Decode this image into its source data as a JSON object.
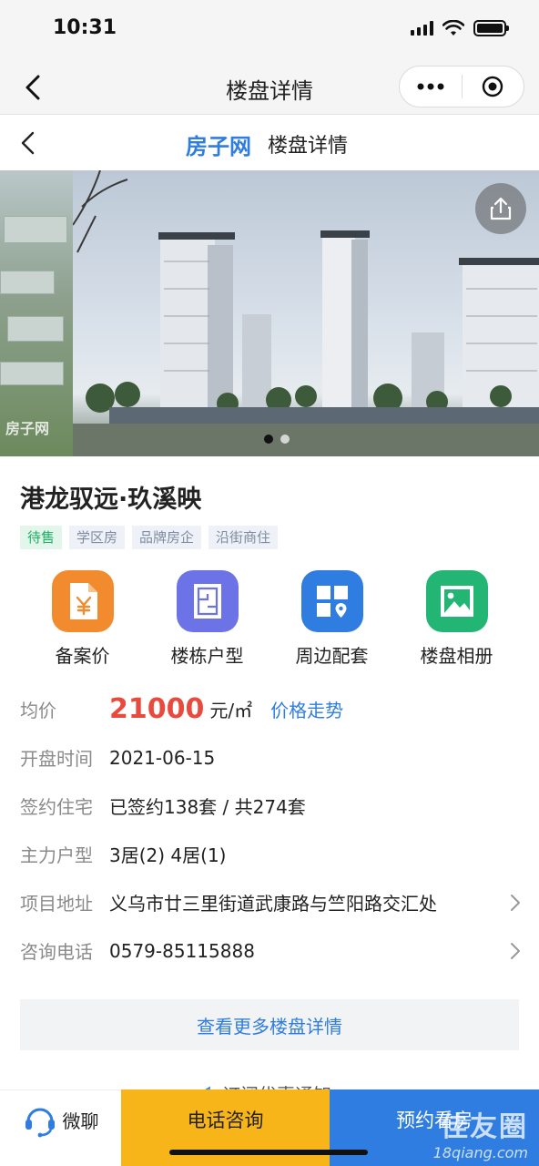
{
  "status_bar": {
    "time": "10:31"
  },
  "mini_program": {
    "title": "楼盘详情"
  },
  "site_header": {
    "brand": "房子网",
    "title": "楼盘详情"
  },
  "banner": {
    "watermark": "房子网",
    "slide_count": 2,
    "active_slide": 1
  },
  "project": {
    "title": "港龙驭远·玖溪映",
    "tags": [
      "待售",
      "学区房",
      "品牌房企",
      "沿街商住"
    ]
  },
  "features": [
    {
      "label": "备案价",
      "icon": "yuan-document-icon",
      "color": "#f28a2e"
    },
    {
      "label": "楼栋户型",
      "icon": "floor-plan-icon",
      "color": "#6b73e6"
    },
    {
      "label": "周边配套",
      "icon": "map-grid-icon",
      "color": "#2f7de1"
    },
    {
      "label": "楼盘相册",
      "icon": "photo-album-icon",
      "color": "#22b573"
    }
  ],
  "info": {
    "price": {
      "label": "均价",
      "value": "21000",
      "unit": "元/㎡",
      "link": "价格走势"
    },
    "open_date": {
      "label": "开盘时间",
      "value": "2021-06-15"
    },
    "signed": {
      "label": "签约住宅",
      "value": "已签约138套 / 共274套"
    },
    "main_layout": {
      "label": "主力户型",
      "value": "3居(2) 4居(1)"
    },
    "address": {
      "label": "项目地址",
      "value": "义乌市廿三里街道武康路与竺阳路交汇处"
    },
    "phone": {
      "label": "咨询电话",
      "value": "0579-85115888"
    }
  },
  "more_button": "查看更多楼盘详情",
  "subscribe_partial": "订阅优惠通知",
  "bottom_bar": {
    "chat": "微聊",
    "call": "电话咨询",
    "book": "预约看房"
  },
  "watermark": {
    "top": "佳友圈",
    "bottom": "18qiang.com"
  },
  "colors": {
    "brand_blue": "#2f7de1",
    "price_red": "#e84a3d",
    "call_yellow": "#f7b519",
    "tag_green": "#1fb065"
  }
}
